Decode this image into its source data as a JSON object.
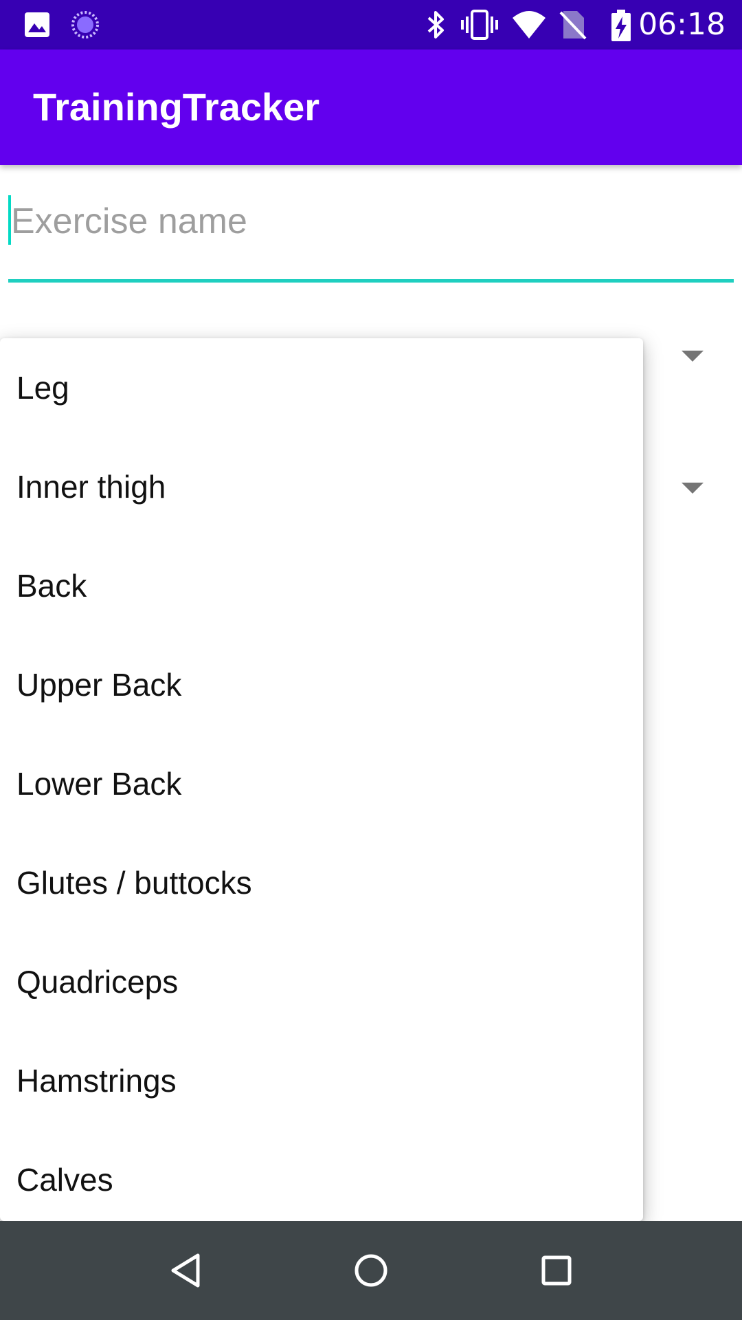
{
  "status_bar": {
    "time": "06:18",
    "icons": [
      "image-icon",
      "sync-icon",
      "bluetooth-icon",
      "vibrate-icon",
      "wifi-icon",
      "no-sim-icon",
      "battery-charging-icon"
    ]
  },
  "app_bar": {
    "title": "TrainingTracker"
  },
  "exercise_input": {
    "placeholder": "Exercise name",
    "value": ""
  },
  "dropdown": {
    "items": [
      "Leg",
      "Inner thigh",
      "Back",
      "Upper Back",
      "Lower Back",
      "Glutes / buttocks",
      "Quadriceps",
      "Hamstrings",
      "Calves"
    ]
  },
  "nav_bar": {
    "buttons": [
      "back-icon",
      "home-icon",
      "recents-icon"
    ]
  },
  "colors": {
    "status_bar": "#3700b3",
    "app_bar": "#6200ee",
    "accent": "#03dac5",
    "nav_bar": "#3f4649"
  }
}
